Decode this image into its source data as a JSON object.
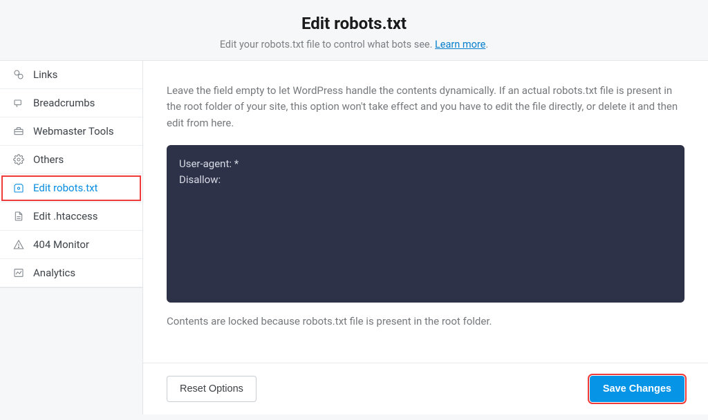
{
  "header": {
    "title": "Edit robots.txt",
    "subtitle_pre": "Edit your robots.txt file to control what bots see. ",
    "learn_more": "Learn more"
  },
  "sidebar": {
    "items": [
      {
        "label": "Links",
        "icon": "links-icon"
      },
      {
        "label": "Breadcrumbs",
        "icon": "breadcrumbs-icon"
      },
      {
        "label": "Webmaster Tools",
        "icon": "toolbox-icon"
      },
      {
        "label": "Others",
        "icon": "gear-icon"
      },
      {
        "label": "Edit robots.txt",
        "icon": "robots-file-icon"
      },
      {
        "label": "Edit .htaccess",
        "icon": "file-icon"
      },
      {
        "label": "404 Monitor",
        "icon": "warning-icon"
      },
      {
        "label": "Analytics",
        "icon": "analytics-icon"
      }
    ]
  },
  "main": {
    "description": "Leave the field empty to let WordPress handle the contents dynamically. If an actual robots.txt file is present in the root folder of your site, this option won't take effect and you have to edit the file directly, or delete it and then edit from here.",
    "editor_value": "User-agent: *\nDisallow:",
    "locked_note": "Contents are locked because robots.txt file is present in the root folder."
  },
  "footer": {
    "reset_label": "Reset Options",
    "save_label": "Save Changes"
  }
}
